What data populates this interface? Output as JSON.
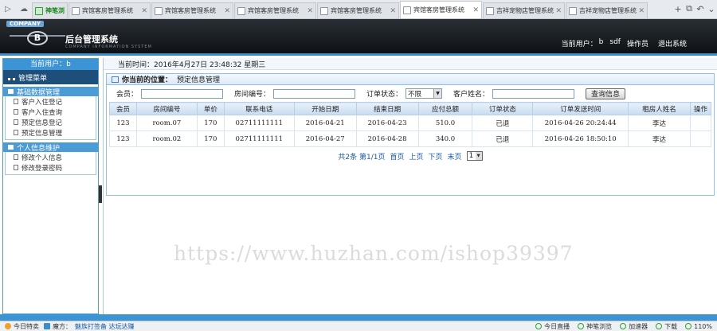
{
  "browser": {
    "first_tab": "神笔浏览",
    "tabs": [
      {
        "title": "宾馆客房管理系统",
        "active": false
      },
      {
        "title": "宾馆客房管理系统",
        "active": false
      },
      {
        "title": "宾馆客房管理系统",
        "active": false
      },
      {
        "title": "宾馆客房管理系统",
        "active": false
      },
      {
        "title": "宾馆客房管理系统",
        "active": true
      },
      {
        "title": "吉祥宠物店管理系统",
        "active": false
      },
      {
        "title": "吉祥宠物店管理系统",
        "active": false
      }
    ]
  },
  "header": {
    "company": "COMPANY",
    "logo_letter": "B",
    "title": "后台管理系统",
    "subtitle": "COMPANY INFORMATION SYSTEM",
    "user_label": "当前用户：",
    "user_name": "b",
    "user_extra": "sdf",
    "role": "操作员",
    "logout": "退出系统"
  },
  "sidebar": {
    "current_user": "当前用户：b",
    "menu_title": "管理菜单",
    "groups": [
      {
        "title": "基础数据管理",
        "items": [
          "客户入住登记",
          "客户入住查询",
          "预定信息登记",
          "预定信息管理"
        ]
      },
      {
        "title": "个人信息维护",
        "items": [
          "修改个人信息",
          "修改登录密码"
        ]
      }
    ]
  },
  "main": {
    "time_text": "当前时间：2016年4月27日  23:48:32  星期三",
    "location_label": "你当前的位置：",
    "location": "预定信息管理",
    "search": {
      "member_label": "会员：",
      "room_label": "房间编号：",
      "status_label": "订单状态：",
      "status_value": "不限",
      "name_label": "客户姓名：",
      "button": "查询信息"
    },
    "columns": [
      "会员",
      "房间编号",
      "单价",
      "联系电话",
      "开始日期",
      "结束日期",
      "应付总额",
      "订单状态",
      "订单发送时间",
      "租房人姓名",
      "操作"
    ],
    "rows": [
      [
        "123",
        "room.07",
        "170",
        "02711111111",
        "2016-04-21",
        "2016-04-23",
        "510.0",
        "已退",
        "2016-04-26 20:24:44",
        "李达",
        ""
      ],
      [
        "123",
        "room.02",
        "170",
        "02711111111",
        "2016-04-27",
        "2016-04-28",
        "340.0",
        "已退",
        "2016-04-26 18:50:10",
        "李达",
        ""
      ]
    ],
    "pager": {
      "summary": "共2条 第1/1页",
      "first": "首页",
      "prev": "上页",
      "next": "下页",
      "last": "末页",
      "page": "1"
    },
    "watermark": "https://www.huzhan.com/ishop39397"
  },
  "statusbar": {
    "item1": "今日特卖",
    "item2": "魔方：",
    "link": "魅族打签备 达玩达赚",
    "right": [
      "今日直播",
      "神笔浏览",
      "加速器",
      "下载",
      "110%"
    ]
  }
}
